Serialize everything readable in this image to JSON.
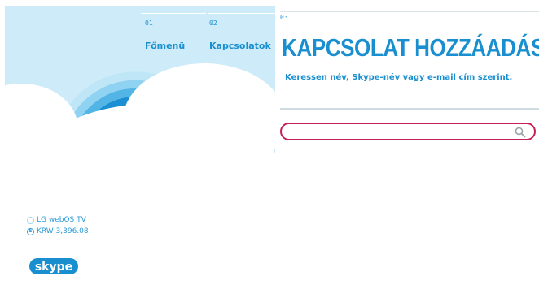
{
  "steps": [
    {
      "number": "01",
      "label": "Főmenü"
    },
    {
      "number": "02",
      "label": "Kapcsolatok"
    },
    {
      "number": "03",
      "label": ""
    }
  ],
  "page": {
    "title": "KAPCSOLAT HOZZÁADÁSA",
    "subtitle": "Keressen név, Skype-név vagy e-mail cím szerint."
  },
  "search": {
    "value": "",
    "placeholder": ""
  },
  "account": {
    "name": "LG webOS TV",
    "credit": "KRW 3,396.08"
  },
  "logo": {
    "text": "skype"
  },
  "colors": {
    "accent": "#1a8fd0",
    "search_border": "#c6215a",
    "sky": "#cdebf8"
  }
}
